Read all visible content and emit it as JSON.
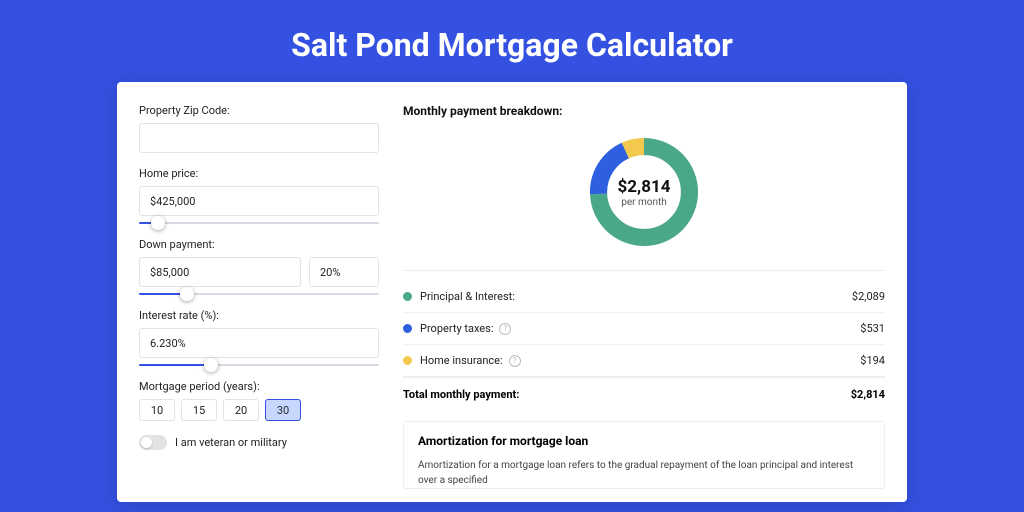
{
  "page_title": "Salt Pond Mortgage Calculator",
  "form": {
    "zip": {
      "label": "Property Zip Code:",
      "value": ""
    },
    "price": {
      "label": "Home price:",
      "value": "$425,000",
      "slider_pct": 8
    },
    "down": {
      "label": "Down payment:",
      "value": "$85,000",
      "pct": "20%",
      "slider_pct": 20
    },
    "rate": {
      "label": "Interest rate (%):",
      "value": "6.230%",
      "slider_pct": 30
    },
    "period": {
      "label": "Mortgage period (years):",
      "options": [
        "10",
        "15",
        "20",
        "30"
      ],
      "active": "30"
    },
    "veteran": {
      "label": "I am veteran or military",
      "on": false
    }
  },
  "breakdown": {
    "title": "Monthly payment breakdown:",
    "center_amount": "$2,814",
    "center_sub": "per month",
    "items": [
      {
        "label": "Principal & Interest:",
        "value": "$2,089",
        "color": "#4aa789",
        "help": false
      },
      {
        "label": "Property taxes:",
        "value": "$531",
        "color": "#2d5fe0",
        "help": true
      },
      {
        "label": "Home insurance:",
        "value": "$194",
        "color": "#f2c94c",
        "help": true
      }
    ],
    "total_label": "Total monthly payment:",
    "total_value": "$2,814"
  },
  "amort": {
    "title": "Amortization for mortgage loan",
    "text": "Amortization for a mortgage loan refers to the gradual repayment of the loan principal and interest over a specified"
  },
  "chart_data": {
    "type": "pie",
    "title": "Monthly payment breakdown",
    "center_value": 2814,
    "center_label": "per month",
    "series": [
      {
        "name": "Principal & Interest",
        "value": 2089,
        "pct": 74.2,
        "color": "#4aa789"
      },
      {
        "name": "Property taxes",
        "value": 531,
        "pct": 18.9,
        "color": "#2d5fe0"
      },
      {
        "name": "Home insurance",
        "value": 194,
        "pct": 6.9,
        "color": "#f2c94c"
      }
    ]
  }
}
